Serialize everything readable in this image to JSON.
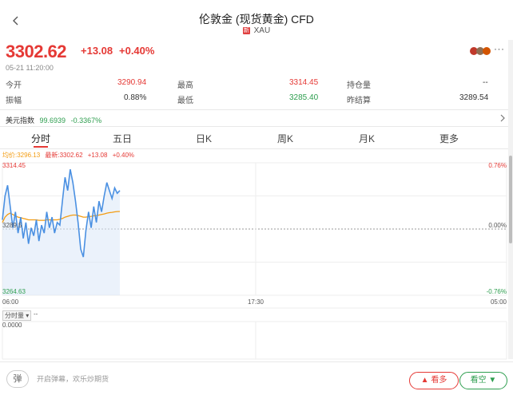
{
  "header": {
    "title": "伦敦金 (现货黄金) CFD",
    "badge": "新",
    "symbol": "XAU"
  },
  "quote": {
    "price": "3302.62",
    "change": "+13.08",
    "change_pct": "+0.40%",
    "time": "05-21 11:20:00",
    "more": "···"
  },
  "stats": [
    {
      "label": "今开",
      "value": "3290.94",
      "label2": "最高",
      "value2": "3314.45",
      "label3": "持仓量",
      "value3": "--"
    },
    {
      "label": "振幅",
      "value": "0.88%",
      "label2": "最低",
      "value2": "3285.40",
      "label3": "昨结算",
      "value3": "3289.54"
    }
  ],
  "usd_index": {
    "label": "美元指数",
    "value": "99.6939",
    "change": "-0.3367%"
  },
  "tabs": [
    "分时",
    "五日",
    "日K",
    "周K",
    "月K",
    "更多"
  ],
  "legend": {
    "avg": "均价:3296.13",
    "latest": "最新:3302.62",
    "change": "+13.08",
    "pct": "+0.40%"
  },
  "chart_data": {
    "type": "line",
    "y_labels": {
      "top": "3314.45",
      "mid": "3289.5",
      "bottom": "3264.63"
    },
    "pct_labels": {
      "top": "0.76%",
      "mid": "0.00%",
      "bottom": "-0.76%"
    },
    "x_labels": [
      "06:00",
      "17:30",
      "05:00"
    ],
    "ylim": [
      3264.63,
      3314.45
    ],
    "base": 3289.54,
    "series": [
      {
        "values": [
          3293,
          3302,
          3306,
          3298,
          3290,
          3296,
          3288,
          3294,
          3286,
          3292,
          3284,
          3290,
          3287,
          3293,
          3285,
          3291,
          3288,
          3296,
          3290,
          3294,
          3288,
          3292,
          3291,
          3300,
          3309,
          3304,
          3312,
          3307,
          3300,
          3292,
          3282,
          3279,
          3289,
          3296,
          3290,
          3298,
          3292,
          3300,
          3296,
          3302,
          3307,
          3304,
          3301,
          3305,
          3303,
          3304
        ]
      },
      {
        "values": [
          3292,
          3294,
          3295,
          3295.5,
          3295,
          3294.5,
          3294,
          3293.8,
          3293.5,
          3293.3,
          3293,
          3293,
          3293,
          3293,
          3292.8,
          3292.8,
          3292.8,
          3293,
          3293,
          3293,
          3293,
          3293,
          3293.2,
          3293.5,
          3294,
          3294.3,
          3294.6,
          3294.8,
          3294.8,
          3294.6,
          3294.3,
          3294,
          3294,
          3294.2,
          3294.3,
          3294.5,
          3294.6,
          3294.8,
          3295,
          3295.2,
          3295.5,
          3295.7,
          3295.8,
          3296,
          3296.1,
          3296.13
        ]
      }
    ]
  },
  "volume": {
    "label": "分时量",
    "value": "--",
    "axis_value": "0.0000"
  },
  "bottom": {
    "danmu_icon": "弹",
    "danmu_text": "开启弹幕，欢乐炒期货",
    "buy": "看多",
    "sell": "看空"
  },
  "colors": {
    "up": "#e53935",
    "down": "#2e9e4f",
    "line": "#4a90e2",
    "avg": "#f39c12"
  }
}
